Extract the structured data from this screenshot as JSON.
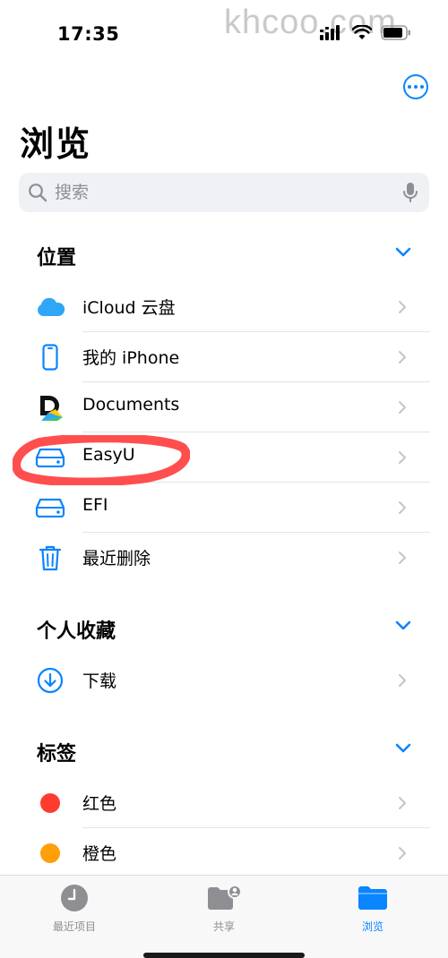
{
  "status": {
    "time": "17:35"
  },
  "watermark": "khcoo.com",
  "page": {
    "title": "浏览"
  },
  "search": {
    "placeholder": "搜索"
  },
  "sections": {
    "locations": {
      "title": "位置",
      "items": [
        {
          "label": "iCloud 云盘",
          "icon": "icloud-icon"
        },
        {
          "label": "我的 iPhone",
          "icon": "iphone-icon"
        },
        {
          "label": "Documents",
          "icon": "documents-app-icon"
        },
        {
          "label": "EasyU",
          "icon": "drive-icon"
        },
        {
          "label": "EFI",
          "icon": "drive-icon"
        },
        {
          "label": "最近删除",
          "icon": "trash-icon"
        }
      ]
    },
    "favorites": {
      "title": "个人收藏",
      "items": [
        {
          "label": "下载",
          "icon": "download-icon"
        }
      ]
    },
    "tags": {
      "title": "标签",
      "items": [
        {
          "label": "红色",
          "color": "#ff3b30"
        },
        {
          "label": "橙色",
          "color": "#ff9f0a"
        }
      ]
    }
  },
  "tabs": [
    {
      "label": "最近项目",
      "icon": "clock-icon",
      "active": false
    },
    {
      "label": "共享",
      "icon": "shared-folder-icon",
      "active": false
    },
    {
      "label": "浏览",
      "icon": "folder-icon",
      "active": true
    }
  ],
  "colors": {
    "accent": "#0a84ff",
    "highlight": "#ff3b3b"
  }
}
